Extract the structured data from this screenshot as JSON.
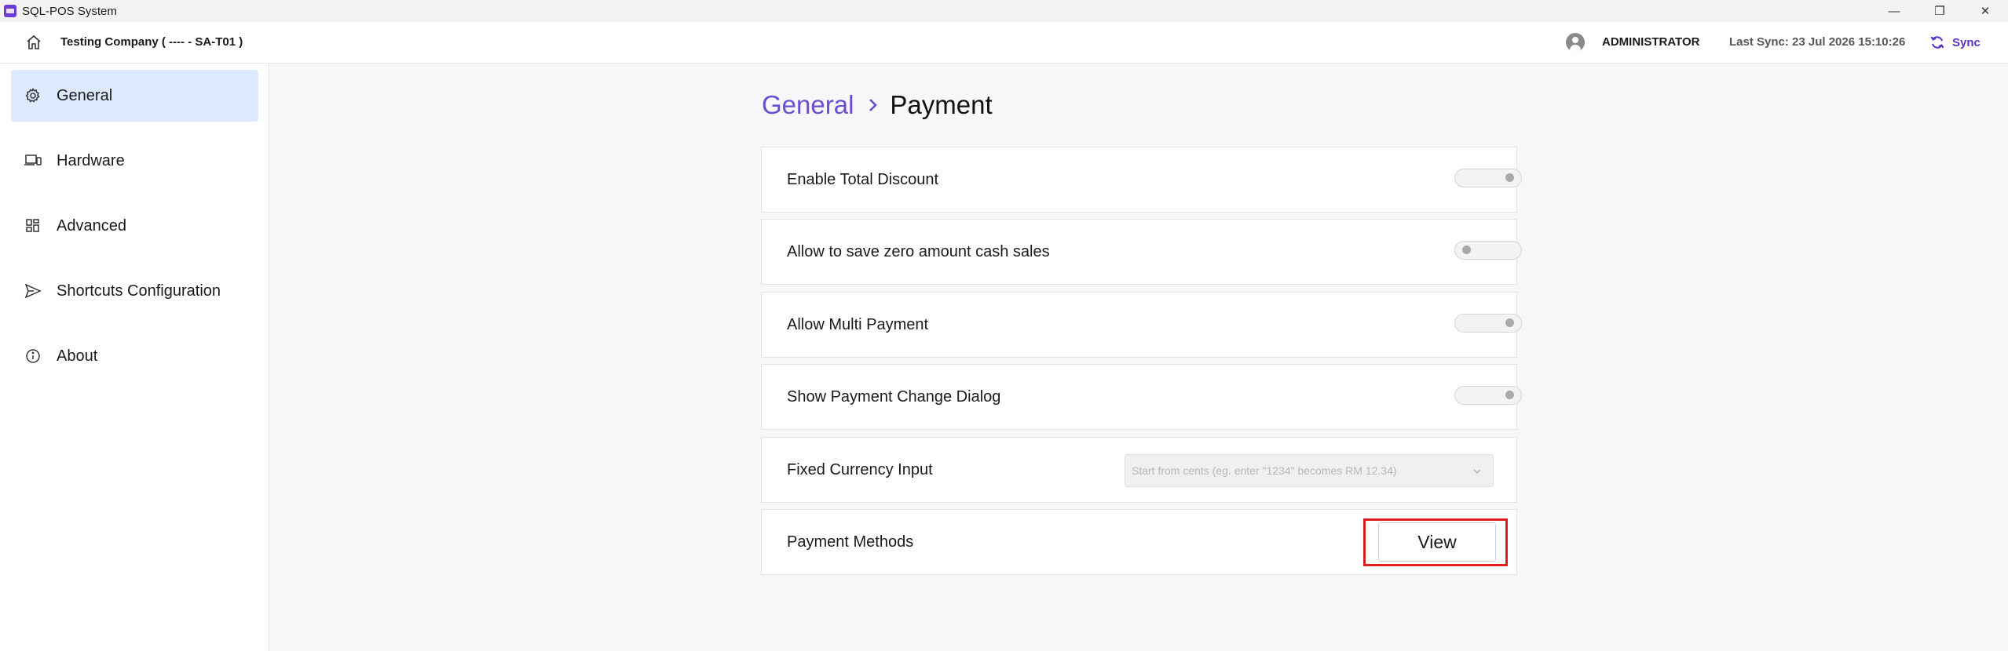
{
  "window": {
    "title": "SQL-POS System",
    "controls": {
      "minimize": "—",
      "restore": "❐",
      "close": "✕"
    }
  },
  "header": {
    "company": "Testing Company ( ---- - SA-T01 )",
    "user": "ADMINISTRATOR",
    "last_sync": "Last Sync: 23 Jul 2026 15:10:26",
    "sync_label": "Sync",
    "accent_color": "#5b2fc9"
  },
  "sidebar": {
    "items": [
      {
        "label": "General",
        "icon": "gear-icon",
        "active": true
      },
      {
        "label": "Hardware",
        "icon": "devices-icon",
        "active": false
      },
      {
        "label": "Advanced",
        "icon": "grid-icon",
        "active": false
      },
      {
        "label": "Shortcuts Configuration",
        "icon": "send-icon",
        "active": false
      },
      {
        "label": "About",
        "icon": "info-icon",
        "active": false
      }
    ]
  },
  "breadcrumb": {
    "parent": "General",
    "current": "Payment"
  },
  "settings": {
    "enable_total_discount": {
      "label": "Enable Total Discount",
      "toggle_on": true
    },
    "allow_zero_cash": {
      "label": "Allow to save zero amount cash sales",
      "toggle_on": false
    },
    "allow_multi_payment": {
      "label": "Allow Multi Payment",
      "toggle_on": true
    },
    "show_change_dialog": {
      "label": "Show Payment Change Dialog",
      "toggle_on": true
    },
    "fixed_currency_input": {
      "label": "Fixed Currency Input",
      "selected": "Start from cents (eg. enter \"1234\" becomes RM 12.34)"
    },
    "payment_methods": {
      "label": "Payment Methods",
      "button_label": "View"
    }
  }
}
